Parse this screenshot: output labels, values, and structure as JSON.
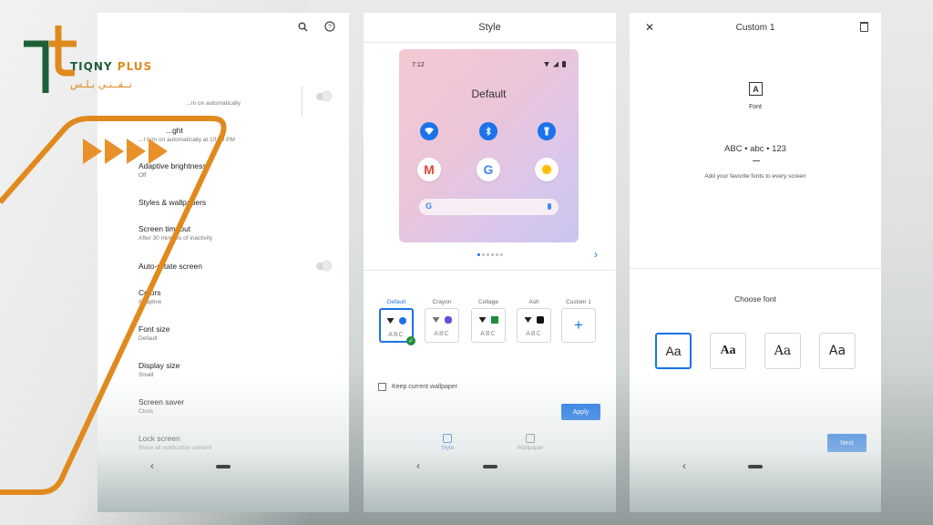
{
  "brand": {
    "name_en_part1": "TIQNY",
    "name_en_part2": "PLUS",
    "name_ar": "تــقــنـي  بـلـس",
    "colors": {
      "green": "#1f5f38",
      "orange": "#e08a1e"
    }
  },
  "colors": {
    "accent": "#1a73e8",
    "success": "#1e8e3e"
  },
  "settings_screen": {
    "icons": [
      "search-icon",
      "help-icon"
    ],
    "items": [
      {
        "title": "",
        "subtitle": "...rn on automatically"
      },
      {
        "title": "...ght",
        "subtitle": "...I turn on automatically at 10:00 PM"
      },
      {
        "title": "Adaptive brightness",
        "subtitle": "Off"
      },
      {
        "title": "Styles & wallpapers",
        "subtitle": ""
      },
      {
        "title": "Screen timeout",
        "subtitle": "After 30 minutes of inactivity"
      },
      {
        "title": "Auto-rotate screen",
        "subtitle": ""
      },
      {
        "title": "Colors",
        "subtitle": "Adaptive"
      },
      {
        "title": "Font size",
        "subtitle": "Default"
      },
      {
        "title": "Display size",
        "subtitle": "Small"
      },
      {
        "title": "Screen saver",
        "subtitle": "Clock"
      },
      {
        "title": "Lock screen",
        "subtitle": "Show all notification content"
      }
    ]
  },
  "style_screen": {
    "title": "Style",
    "preview": {
      "time": "7:12",
      "theme_name": "Default",
      "search_logo": "G"
    },
    "apps": [
      "M",
      "G",
      "✺"
    ],
    "options": [
      {
        "label": "Default",
        "sample": "ABC"
      },
      {
        "label": "Crayon",
        "sample": "ABC"
      },
      {
        "label": "Collage",
        "sample": "ABC"
      },
      {
        "label": "Ash",
        "sample": "ABC"
      },
      {
        "label": "Custom 1",
        "sample": "+"
      }
    ],
    "keep_wallpaper_label": "Keep current wallpaper",
    "apply_label": "Apply",
    "bottom_tabs": [
      {
        "label": "Style",
        "active": true
      },
      {
        "label": "Wallpaper",
        "active": false
      }
    ]
  },
  "custom_screen": {
    "title": "Custom 1",
    "font_icon_glyph": "A",
    "section_label": "Font",
    "sample_text": "ABC • abc • 123",
    "description": "Add your favorite fonts to every screen",
    "choose_label": "Choose font",
    "font_options": [
      "Aa",
      "Aa",
      "Aa",
      "Aa"
    ],
    "next_label": "Next"
  }
}
